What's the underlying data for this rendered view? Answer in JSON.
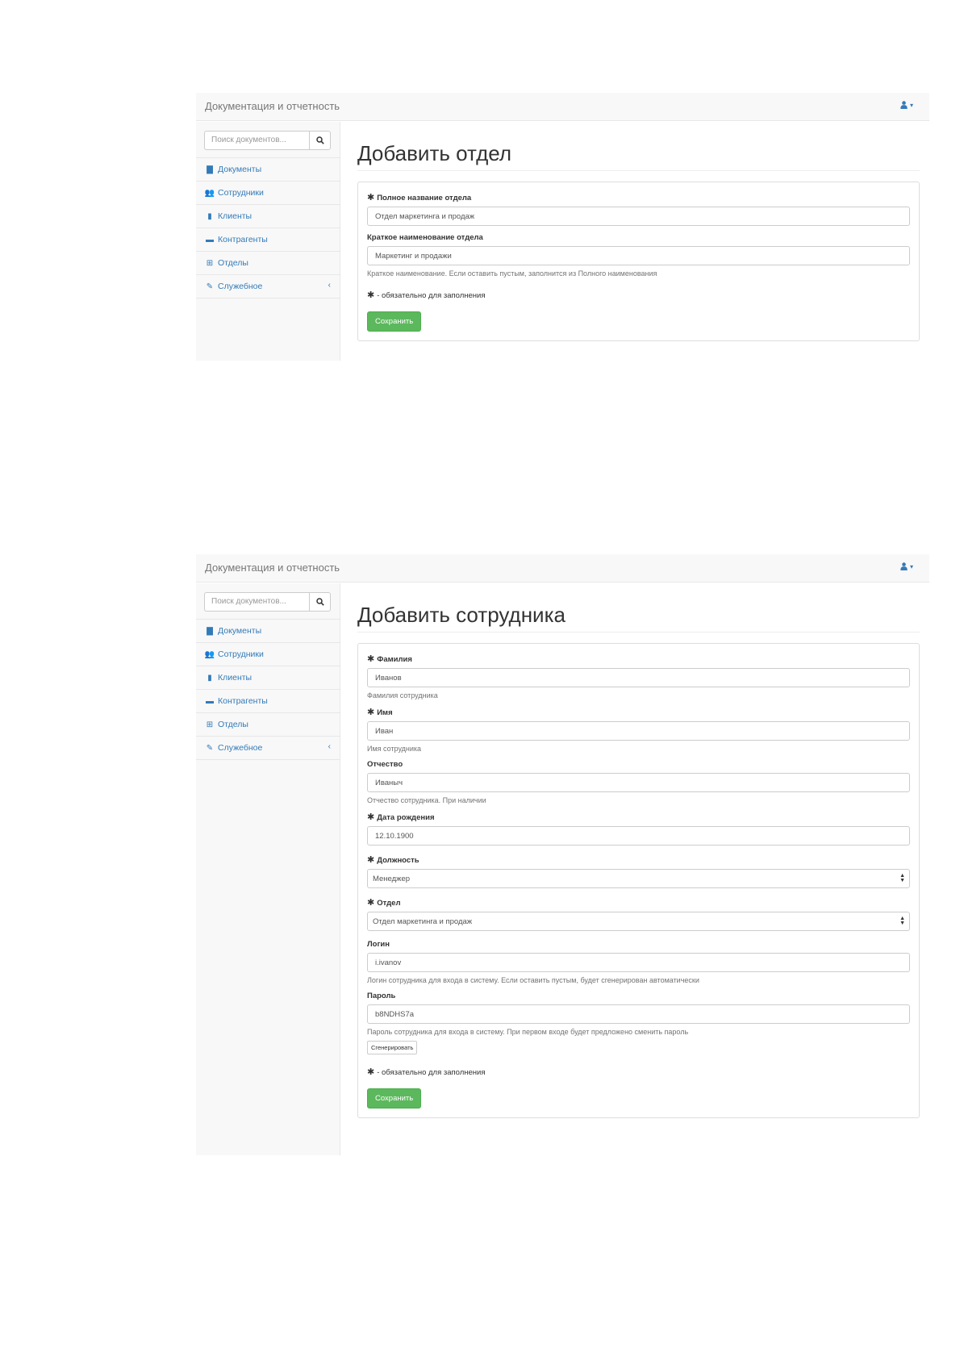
{
  "app": {
    "brand": "Документация и отчетность"
  },
  "search": {
    "placeholder": "Поиск документов..."
  },
  "sidebar": {
    "items": [
      {
        "label": "Документы",
        "icon": "file-icon"
      },
      {
        "label": "Сотрудники",
        "icon": "users-icon"
      },
      {
        "label": "Клиенты",
        "icon": "book-icon"
      },
      {
        "label": "Контрагенты",
        "icon": "briefcase-icon"
      },
      {
        "label": "Отделы",
        "icon": "sitemap-icon"
      },
      {
        "label": "Служебное",
        "icon": "wrench-icon",
        "arrow": "‹"
      }
    ]
  },
  "dept_form": {
    "title": "Добавить отдел",
    "full_name": {
      "label": "Полное название отдела",
      "value": "Отдел маркетинга и продаж"
    },
    "short_name": {
      "label": "Краткое наименование отдела",
      "value": "Маркетинг и продажи",
      "help": "Краткое наименование. Если оставить пустым, заполнится из Полного наименования"
    },
    "required_note": "- обязательно для заполнения",
    "save_label": "Сохранить"
  },
  "emp_form": {
    "title": "Добавить сотрудника",
    "last_name": {
      "label": "Фамилия",
      "value": "Иванов",
      "help": "Фамилия сотрудника"
    },
    "first_name": {
      "label": "Имя",
      "value": "Иван",
      "help": "Имя сотрудника"
    },
    "patronymic": {
      "label": "Отчество",
      "value": "Иваныч",
      "help": "Отчество сотрудника. При наличии"
    },
    "birth_date": {
      "label": "Дата рождения",
      "value": "12.10.1900"
    },
    "position": {
      "label": "Должность",
      "value": "Менеджер"
    },
    "department": {
      "label": "Отдел",
      "value": "Отдел маркетинга и продаж"
    },
    "login": {
      "label": "Логин",
      "value": "i.ivanov",
      "help": "Логин сотрудника для входа в систему. Если оставить пустым, будет сгенерирован автоматически"
    },
    "password": {
      "label": "Пароль",
      "value": "b8NDHS7a",
      "help": "Пароль сотрудника для входа в систему. При первом входе будет предложено сменить пароль",
      "generate_label": "Сгенерировать"
    },
    "required_note": "- обязательно для заполнения",
    "save_label": "Сохранить"
  },
  "colors": {
    "link": "#337ab7",
    "success": "#5cb85c",
    "navbar": "#f8f8f8"
  }
}
